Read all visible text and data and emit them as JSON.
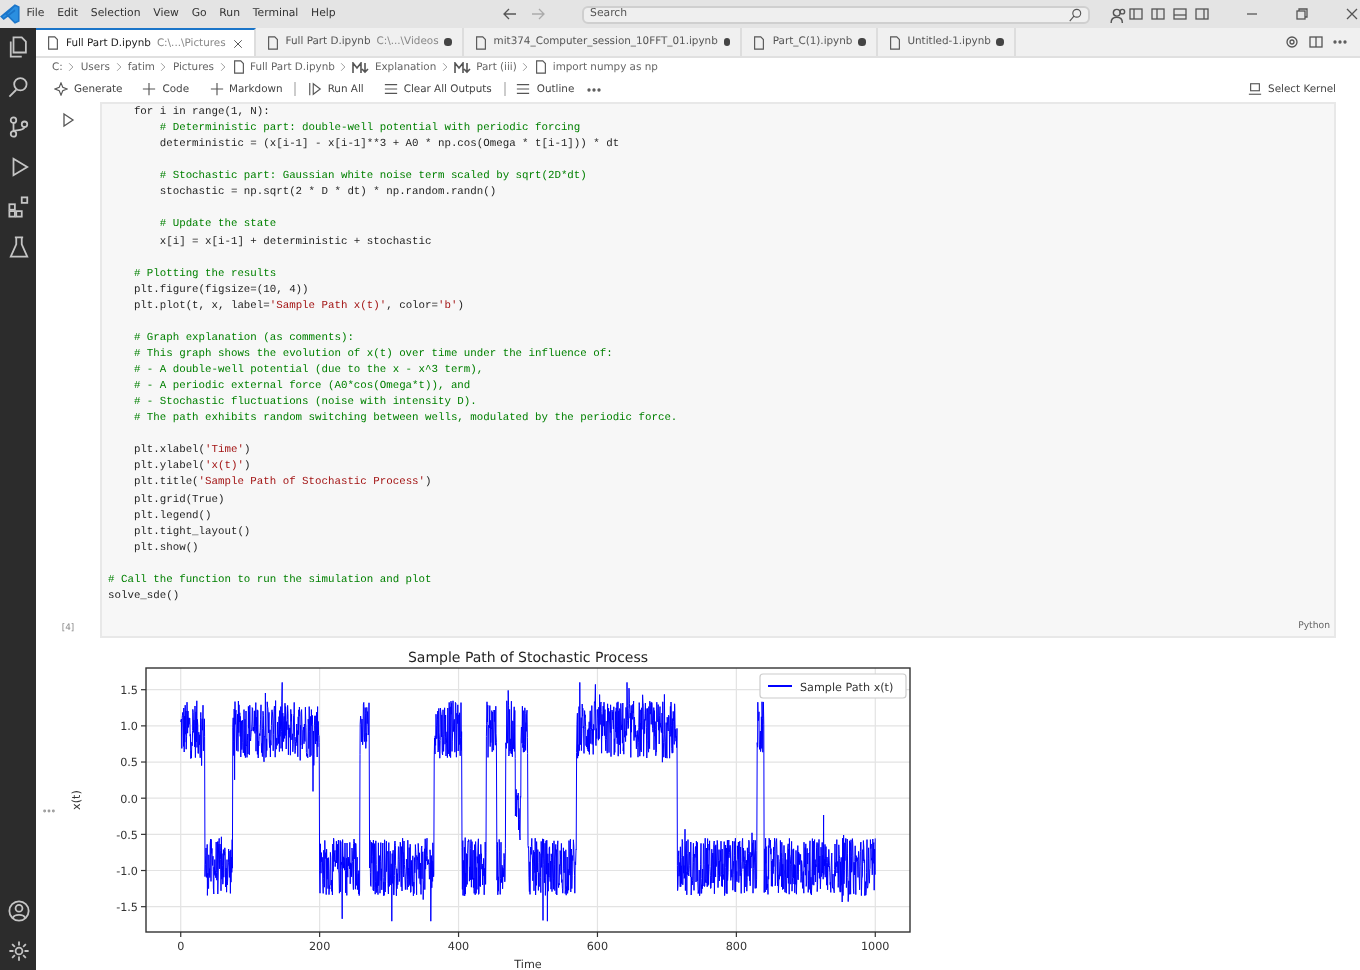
{
  "menu": [
    "File",
    "Edit",
    "Selection",
    "View",
    "Go",
    "Run",
    "Terminal",
    "Help"
  ],
  "search": {
    "placeholder": "Search"
  },
  "tabs": [
    {
      "label": "Full Part D.ipynb",
      "path": "C:\\...\\Pictures",
      "selected": true,
      "modified": false
    },
    {
      "label": "Full Part D.ipynb",
      "path": "C:\\...\\Videos",
      "selected": false,
      "modified": true
    },
    {
      "label": "mit374_Computer_session_10FFT_01.ipynb",
      "selected": false,
      "modified": true
    },
    {
      "label": "Part_C(1).ipynb",
      "selected": false,
      "modified": true
    },
    {
      "label": "Untitled-1.ipynb",
      "selected": false,
      "modified": true
    }
  ],
  "breadcrumb": [
    {
      "label": "C:",
      "kind": "plain"
    },
    {
      "label": "Users",
      "kind": "plain"
    },
    {
      "label": "fatim",
      "kind": "plain"
    },
    {
      "label": "Pictures",
      "kind": "plain"
    },
    {
      "label": "Full Part D.ipynb",
      "kind": "file"
    },
    {
      "label": "Explanation",
      "kind": "markdown"
    },
    {
      "label": "Part (iii)",
      "kind": "markdown"
    },
    {
      "label": "import numpy as np",
      "kind": "file"
    }
  ],
  "toolbar": [
    {
      "label": "Generate",
      "kind": "sparkle"
    },
    {
      "label": "Code",
      "kind": "plus"
    },
    {
      "label": "Markdown",
      "kind": "plus"
    },
    {
      "label": "Run All",
      "kind": "run"
    },
    {
      "label": "Clear All Outputs",
      "kind": "clear"
    },
    {
      "label": "Outline",
      "kind": "list"
    }
  ],
  "kernel": "Select Kernel",
  "cell": {
    "execution_count": "[4]",
    "language": "Python",
    "lines": [
      {
        "kind": "code",
        "text": "    for i in range(1, N):"
      },
      {
        "kind": "comment",
        "text": "        # Deterministic part: double-well potential with periodic forcing"
      },
      {
        "kind": "code",
        "text": "        deterministic = (x[i-1] - x[i-1]**3 + A0 * np.cos(Omega * t[i-1])) * dt"
      },
      {
        "kind": "blank"
      },
      {
        "kind": "comment",
        "text": "        # Stochastic part: Gaussian white noise term scaled by sqrt(2D*dt)"
      },
      {
        "kind": "code",
        "text": "        stochastic = np.sqrt(2 * D * dt) * np.random.randn()"
      },
      {
        "kind": "blank"
      },
      {
        "kind": "comment",
        "text": "        # Update the state"
      },
      {
        "kind": "code",
        "text": "        x[i] = x[i-1] + deterministic + stochastic"
      },
      {
        "kind": "blank"
      },
      {
        "kind": "comment",
        "text": "    # Plotting the results"
      },
      {
        "kind": "code",
        "text": "    plt.figure(figsize=(10, 4))"
      },
      {
        "kind": "code",
        "text": "    plt.plot(t, x, label='Sample Path x(t)', color='b')"
      },
      {
        "kind": "blank"
      },
      {
        "kind": "comment",
        "text": "    # Graph explanation (as comments):"
      },
      {
        "kind": "comment",
        "text": "    # This graph shows the evolution of x(t) over time under the influence of:"
      },
      {
        "kind": "comment",
        "text": "    # - A double-well potential (due to the x - x^3 term),"
      },
      {
        "kind": "comment",
        "text": "    # - A periodic external force (A0*cos(Omega*t)), and"
      },
      {
        "kind": "comment",
        "text": "    # - Stochastic fluctuations (noise with intensity D)."
      },
      {
        "kind": "comment",
        "text": "    # The path exhibits random switching between wells, modulated by the periodic force."
      },
      {
        "kind": "blank"
      },
      {
        "kind": "code",
        "text": "    plt.xlabel('Time')"
      },
      {
        "kind": "code",
        "text": "    plt.ylabel('x(t)')"
      },
      {
        "kind": "code",
        "text": "    plt.title('Sample Path of Stochastic Process')"
      },
      {
        "kind": "code",
        "text": "    plt.grid(True)"
      },
      {
        "kind": "code",
        "text": "    plt.legend()"
      },
      {
        "kind": "code",
        "text": "    plt.tight_layout()"
      },
      {
        "kind": "code",
        "text": "    plt.show()"
      },
      {
        "kind": "blank"
      },
      {
        "kind": "comment",
        "text": "# Call the function to run the simulation and plot"
      },
      {
        "kind": "code",
        "text": "solve_sde()"
      }
    ]
  },
  "output": {
    "title": "Sample Path of Stochastic Process",
    "xlabel": "Time",
    "ylabel": "x(t)",
    "legend": "Sample Path x(t)",
    "xticks": [
      "0",
      "200",
      "400",
      "600",
      "800",
      "1000"
    ],
    "yticks": [
      "1.5",
      "1.0",
      "0.5",
      "0.0",
      "-0.5",
      "-1.0",
      "-1.5"
    ]
  }
}
